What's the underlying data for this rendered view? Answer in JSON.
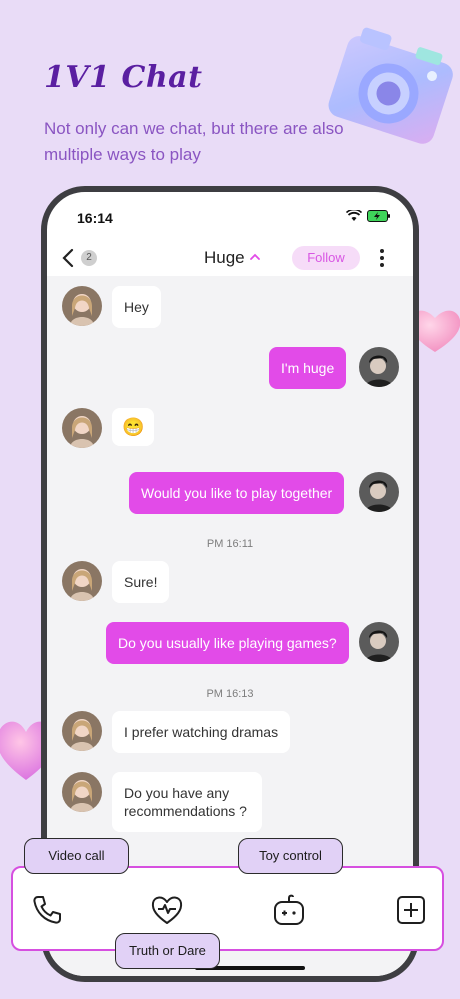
{
  "promo": {
    "title": "1V1 Chat",
    "subtitle": "Not only can we chat, but there are also multiple ways to play"
  },
  "status_bar": {
    "time": "16:14"
  },
  "header": {
    "back_badge": "2",
    "name": "Huge",
    "follow_label": "Follow"
  },
  "messages": [
    {
      "side": "in",
      "text": "Hey"
    },
    {
      "side": "out",
      "text": "I'm huge"
    },
    {
      "side": "in",
      "text": "😁"
    },
    {
      "side": "out",
      "text": "Would you like to play together"
    },
    {
      "side": "time",
      "text": "PM 16:11"
    },
    {
      "side": "in",
      "text": "Sure!"
    },
    {
      "side": "out",
      "text": "Do you usually like playing games?"
    },
    {
      "side": "time",
      "text": "PM 16:13"
    },
    {
      "side": "in",
      "text": "I prefer watching dramas"
    },
    {
      "side": "in",
      "text": "Do you have any recommendations ?"
    }
  ],
  "tools": {
    "video_call": "Video call",
    "truth_or_dare": "Truth or Dare",
    "toy_control": "Toy control"
  },
  "colors": {
    "accent": "#e24be8",
    "background": "#e9dcf7",
    "title": "#5a1fa1",
    "tooltip_fill": "#e1d1f6"
  },
  "icons": [
    "phone-icon",
    "heart-pulse-icon",
    "gamepad-icon",
    "plus-square-icon",
    "camera-icon",
    "heart-icon"
  ]
}
